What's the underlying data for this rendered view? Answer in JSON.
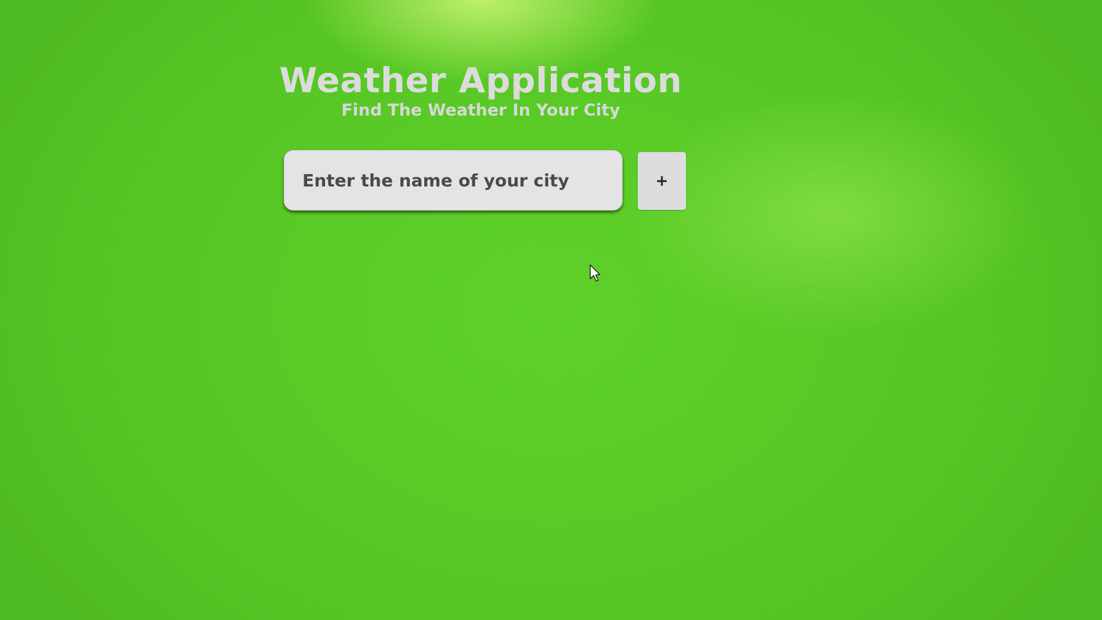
{
  "header": {
    "title": "Weather Application",
    "subtitle": "Find The Weather In Your City"
  },
  "search": {
    "placeholder": "Enter the name of your city",
    "value": ""
  },
  "add_button": {
    "label": "+"
  },
  "colors": {
    "background": "#58c826",
    "title_text": "#dcdcdc",
    "input_background": "#e4e4e4",
    "button_background": "#dddde0"
  },
  "icons": {
    "cursor": "mouse-pointer-icon"
  }
}
